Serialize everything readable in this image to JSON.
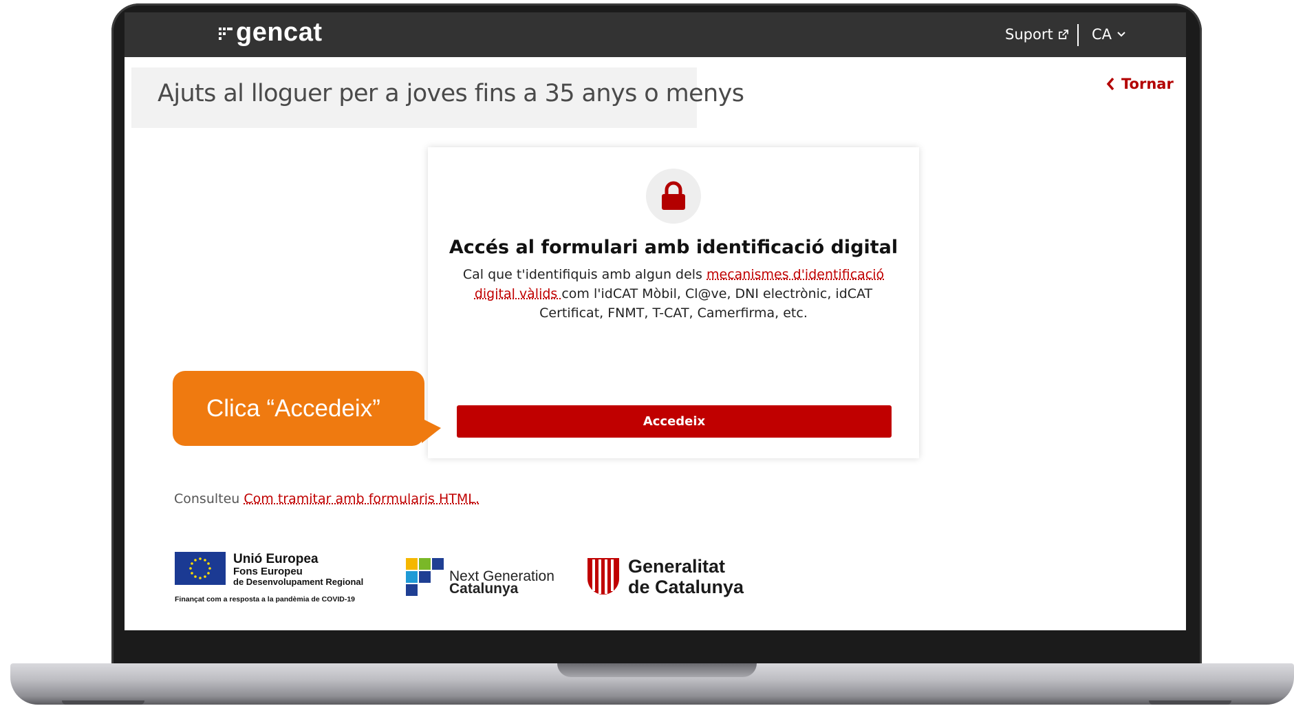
{
  "header": {
    "logo_text": "gencat",
    "support_label": "Suport",
    "language_label": "CA"
  },
  "page": {
    "title": "Ajuts al lloguer per a joves fins a 35 anys o menys",
    "back_label": "Tornar"
  },
  "card": {
    "heading": "Accés al formulari amb identificació digital",
    "desc_before": "Cal que t'identifiquis amb algun dels ",
    "desc_link": "mecanismes d'identificació digital vàlids ",
    "desc_after": "com l'idCAT Mòbil, Cl@ve, DNI electrònic, idCAT Certificat, FNMT, T-CAT, Camerfirma, etc.",
    "button_label": "Accedeix"
  },
  "callout": {
    "text": "Clica “Accedeix”"
  },
  "footer": {
    "consult_prefix": "Consulteu ",
    "consult_link": "Com tramitar amb formularis HTML."
  },
  "logos": {
    "eu_title": "Unió Europea",
    "eu_fund_line1": "Fons Europeu",
    "eu_fund_line2": "de Desenvolupament Regional",
    "eu_note": "Finançat com a resposta a la pandèmia de COVID-19",
    "ng_line1": "Next Generation",
    "ng_line2": "Catalunya",
    "gc_line1": "Generalitat",
    "gc_line2": "de Catalunya"
  },
  "colors": {
    "brand_red": "#c00000",
    "header_bg": "#333333",
    "callout_orange": "#ef7a10"
  },
  "icons": {
    "external_link": "external-link-icon",
    "chevron_down": "chevron-down-icon",
    "chevron_left": "chevron-left-icon",
    "lock": "lock-icon"
  }
}
